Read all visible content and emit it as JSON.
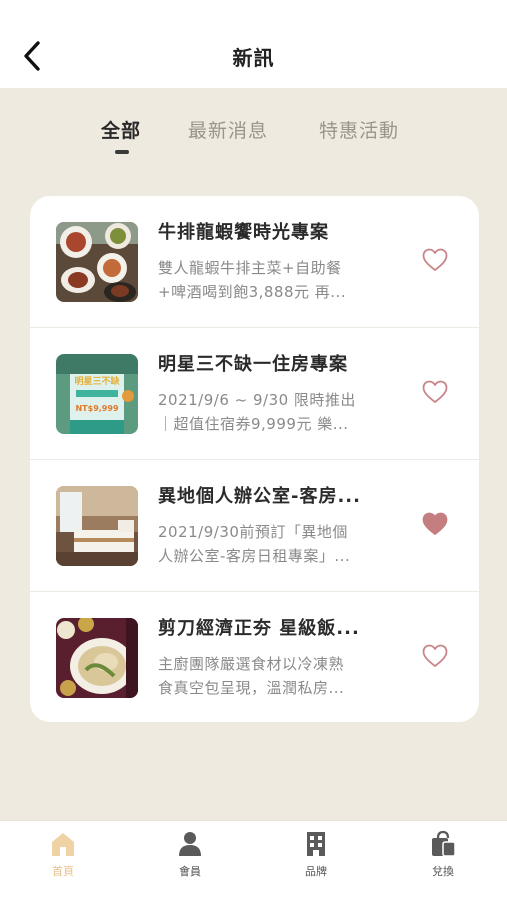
{
  "header": {
    "title": "新訊"
  },
  "tabs": [
    {
      "label": "全部",
      "active": true
    },
    {
      "label": "最新消息",
      "active": false
    },
    {
      "label": "特惠活動",
      "active": false
    }
  ],
  "news": [
    {
      "title": "牛排龍蝦饗時光專案",
      "desc_line1": "雙人龍蝦牛排主菜+自助餐",
      "desc_line2": "+啤酒喝到飽3,888元 再...",
      "favorited": false
    },
    {
      "title": "明星三不缺一住房專案",
      "desc_line1": "2021/9/6 ~ 9/30 限時推出",
      "desc_line2": "｜超值住宿券9,999元 樂...",
      "favorited": false,
      "thumb_text": {
        "title": "明星三不缺",
        "price": "NT$9,999"
      }
    },
    {
      "title": "異地個人辦公室-客房...",
      "desc_line1": "2021/9/30前預訂「異地個",
      "desc_line2": "人辦公室-客房日租專案」...",
      "favorited": true
    },
    {
      "title": "剪刀經濟正夯 星級飯...",
      "desc_line1": "主廚團隊嚴選食材以冷凍熟",
      "desc_line2": "食真空包呈現，溫潤私房...",
      "favorited": false
    }
  ],
  "bottom_nav": [
    {
      "label": "首頁",
      "icon": "home-icon",
      "active": true
    },
    {
      "label": "會員",
      "icon": "member-icon",
      "active": false
    },
    {
      "label": "品牌",
      "icon": "building-icon",
      "active": false
    },
    {
      "label": "兌換",
      "icon": "shopping-bag-icon",
      "active": false
    }
  ],
  "colors": {
    "background": "#efeadf",
    "heart_outline": "#c8868a",
    "heart_filled": "#c47e80",
    "nav_active": "#f0d3a4",
    "nav_inactive": "#5a5a5a"
  }
}
